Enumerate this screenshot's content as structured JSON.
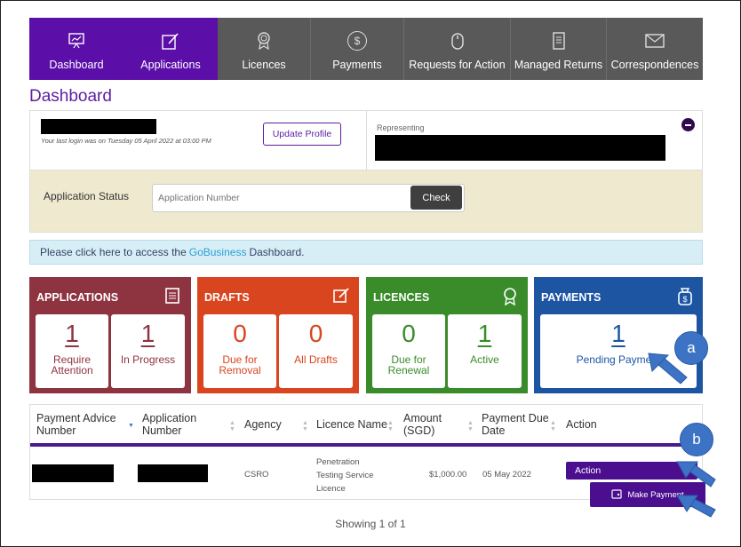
{
  "nav": {
    "items": [
      {
        "label": "Dashboard",
        "icon": "presentation-board-icon",
        "active": true
      },
      {
        "label": "Applications",
        "icon": "edit-document-icon",
        "active": true
      },
      {
        "label": "Licences",
        "icon": "award-ribbon-icon",
        "active": false
      },
      {
        "label": "Payments",
        "icon": "dollar-coin-icon",
        "active": false
      },
      {
        "label": "Requests for Action",
        "icon": "mouse-icon",
        "active": false
      },
      {
        "label": "Managed Returns",
        "icon": "document-list-icon",
        "active": false
      },
      {
        "label": "Correspondences",
        "icon": "envelope-icon",
        "active": false
      }
    ]
  },
  "page_title": "Dashboard",
  "profile": {
    "last_login": "Your last login was on Tuesday 05 April 2022 at 03:00 PM",
    "update_button": "Update Profile",
    "representing_label": "Representing"
  },
  "app_status": {
    "label": "Application Status",
    "input_placeholder": "Application Number",
    "check_button": "Check"
  },
  "banner": {
    "prefix": "Please click here to access the",
    "link": "GoBusiness",
    "suffix": "Dashboard."
  },
  "tiles": {
    "applications": {
      "title": "APPLICATIONS",
      "color": "#8e3340",
      "items": [
        {
          "value": "1",
          "label": "Require Attention"
        },
        {
          "value": "1",
          "label": "In Progress"
        }
      ]
    },
    "drafts": {
      "title": "DRAFTS",
      "color": "#d9451f",
      "items": [
        {
          "value": "0",
          "label": "Due for Removal"
        },
        {
          "value": "0",
          "label": "All Drafts"
        }
      ]
    },
    "licences": {
      "title": "LICENCES",
      "color": "#3a8c2a",
      "items": [
        {
          "value": "0",
          "label": "Due for Renewal"
        },
        {
          "value": "1",
          "label": "Active"
        }
      ]
    },
    "payments": {
      "title": "PAYMENTS",
      "color": "#1d55a3",
      "items": [
        {
          "value": "1",
          "label": "Pending Payment"
        }
      ]
    }
  },
  "table": {
    "headers": [
      "Payment Advice Number",
      "Application Number",
      "Agency",
      "Licence Name",
      "Amount (SGD)",
      "Payment Due Date",
      "Action"
    ],
    "row": {
      "agency": "CSRO",
      "licence_name": "Penetration Testing Service Licence",
      "amount": "$1,000.00",
      "due_date": "05 May 2022",
      "action_button": "Action",
      "make_payment": "Make Payment"
    },
    "showing": "Showing 1 of 1"
  },
  "callouts": [
    "a",
    "b"
  ]
}
